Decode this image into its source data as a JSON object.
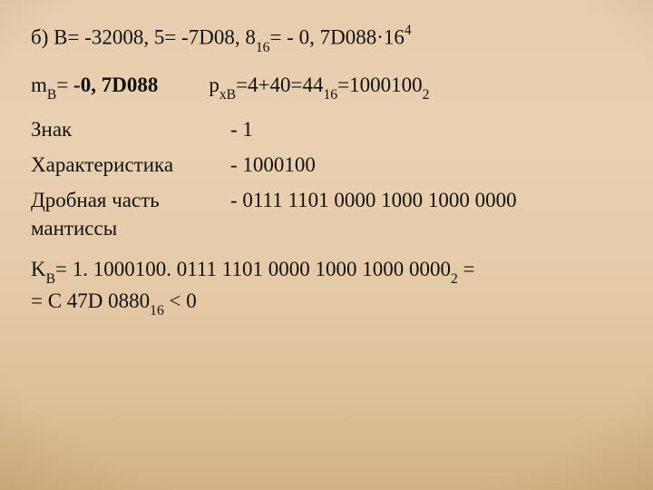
{
  "line1": {
    "lead": "б) B= -32008, 5= -7D08, 8",
    "sub1": "16",
    "eq": "= - 0, 7D088·16",
    "sup1": "4"
  },
  "line2": {
    "mlabel": "m",
    "msub": "B",
    "meq": "= ",
    "mval": "-0, 7D088",
    "plabel": "p",
    "psub": "xB",
    "peq1": "=4+40=44",
    "psub2": "16",
    "peq2": "=1000100",
    "psub3": "2"
  },
  "rows": [
    {
      "label": "Знак",
      "value": "- 1"
    },
    {
      "label": "Характеристика",
      "value": "- 1000100"
    },
    {
      "label": "Дробная часть мантиссы",
      "value": "- 0111 1101 0000 1000 1000 0000"
    }
  ],
  "result": {
    "p1a": "K",
    "p1sub": "B",
    "p1b": "= 1. 1000100. 0111 1101 0000 1000 1000 0000",
    "p1sub2": "2",
    "p1c": " =",
    "p2a": "= C 47D 0880",
    "p2sub": "16",
    "p2b": " < 0"
  }
}
